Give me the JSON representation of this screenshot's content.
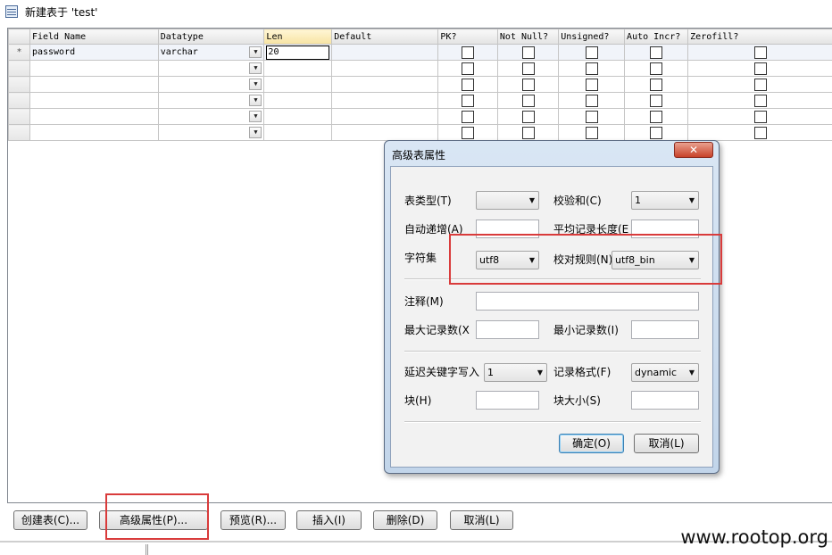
{
  "window": {
    "title": "新建表于 'test'"
  },
  "grid": {
    "columns": [
      "Field Name",
      "Datatype",
      "Len",
      "Default",
      "PK?",
      "Not Null?",
      "Unsigned?",
      "Auto Incr?",
      "Zerofill?"
    ],
    "rows": [
      {
        "marker": "*",
        "field_name": "password",
        "datatype": "varchar",
        "len": "20",
        "default": ""
      },
      {
        "marker": "",
        "field_name": "",
        "datatype": "",
        "len": "",
        "default": ""
      },
      {
        "marker": "",
        "field_name": "",
        "datatype": "",
        "len": "",
        "default": ""
      },
      {
        "marker": "",
        "field_name": "",
        "datatype": "",
        "len": "",
        "default": ""
      },
      {
        "marker": "",
        "field_name": "",
        "datatype": "",
        "len": "",
        "default": ""
      },
      {
        "marker": "",
        "field_name": "",
        "datatype": "",
        "len": "",
        "default": ""
      }
    ]
  },
  "dialog": {
    "title": "高级表属性",
    "close_glyph": "✕",
    "fields": {
      "table_type_label": "表类型(T)",
      "table_type_value": "",
      "checksum_label": "校验和(C)",
      "checksum_value": "1",
      "auto_inc_label": "自动递增(A)",
      "auto_inc_value": "",
      "avg_row_len_label": "平均记录长度(E",
      "avg_row_len_value": "",
      "charset_label": "字符集",
      "charset_value": "utf8",
      "collation_label": "校对规则(N)",
      "collation_value": "utf8_bin",
      "comment_label": "注释(M)",
      "comment_value": "",
      "max_rows_label": "最大记录数(X",
      "max_rows_value": "",
      "min_rows_label": "最小记录数(I)",
      "min_rows_value": "",
      "delay_key_label": "延迟关键字写入",
      "delay_key_value": "1",
      "row_format_label": "记录格式(F)",
      "row_format_value": "dynamic",
      "block_label": "块(H)",
      "block_value": "",
      "block_size_label": "块大小(S)",
      "block_size_value": ""
    },
    "ok_label": "确定(O)",
    "cancel_label": "取消(L)"
  },
  "buttons": {
    "create": "创建表(C)...",
    "advanced": "高级属性(P)...",
    "preview": "预览(R)...",
    "insert": "插入(I)",
    "delete": "删除(D)",
    "cancel": "取消(L)"
  },
  "watermark": "www.rootop.org",
  "colors": {
    "highlight_red": "#d93b3b",
    "dialog_frame": "#c2d5ea",
    "close_button": "#c8422a"
  },
  "icons": {
    "window": "table-icon",
    "dropdown": "chevron-down-icon",
    "close": "close-icon"
  }
}
